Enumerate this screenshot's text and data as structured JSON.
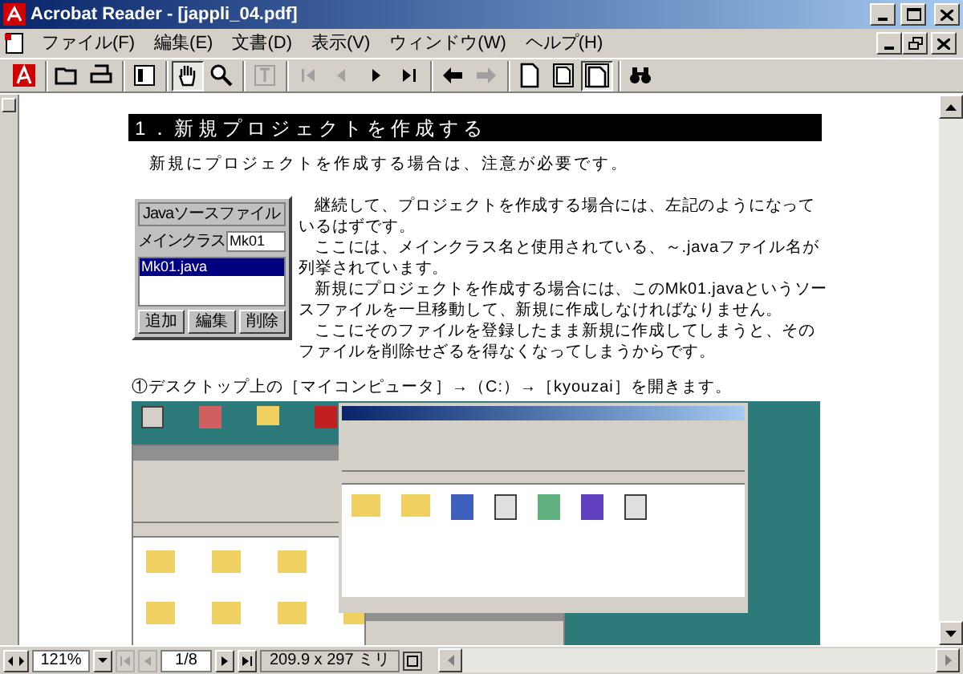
{
  "window": {
    "title": "Acrobat Reader - [jappli_04.pdf]"
  },
  "menu": [
    "ファイル(F)",
    "編集(E)",
    "文書(D)",
    "表示(V)",
    "ウィンドウ(W)",
    "ヘルプ(H)"
  ],
  "toolbar_groups": [
    {
      "buttons": [
        {
          "kind": "acrobat",
          "selected": false,
          "disabled": false
        }
      ]
    },
    {
      "buttons": [
        {
          "kind": "open",
          "selected": false,
          "disabled": false
        },
        {
          "kind": "print",
          "selected": false,
          "disabled": false
        }
      ]
    },
    {
      "buttons": [
        {
          "kind": "navpane",
          "selected": false,
          "disabled": false
        }
      ]
    },
    {
      "buttons": [
        {
          "kind": "hand",
          "selected": true,
          "disabled": false
        },
        {
          "kind": "zoom",
          "selected": false,
          "disabled": false
        }
      ]
    },
    {
      "buttons": [
        {
          "kind": "text",
          "selected": false,
          "disabled": true
        }
      ]
    },
    {
      "buttons": [
        {
          "kind": "first",
          "selected": false,
          "disabled": true
        },
        {
          "kind": "prev",
          "selected": false,
          "disabled": true
        },
        {
          "kind": "next",
          "selected": false,
          "disabled": false
        },
        {
          "kind": "last",
          "selected": false,
          "disabled": false
        }
      ]
    },
    {
      "buttons": [
        {
          "kind": "back",
          "selected": false,
          "disabled": false
        },
        {
          "kind": "forward",
          "selected": false,
          "disabled": true
        }
      ]
    },
    {
      "buttons": [
        {
          "kind": "actual",
          "selected": false,
          "disabled": false
        },
        {
          "kind": "fitpage",
          "selected": false,
          "disabled": false
        },
        {
          "kind": "fitwidth",
          "selected": true,
          "disabled": false
        }
      ]
    },
    {
      "buttons": [
        {
          "kind": "find",
          "selected": false,
          "disabled": false
        }
      ]
    }
  ],
  "document": {
    "heading": "1．新規プロジェクトを作成する",
    "intro": "新規にプロジェクトを作成する場合は、注意が必要です。",
    "dialog": {
      "group_label": "Javaソースファイル",
      "field_label": "メインクラス",
      "field_value": "Mk01",
      "list_items": [
        {
          "label": "Mk01.java",
          "selected": true
        }
      ],
      "buttons": [
        "追加",
        "編集",
        "削除"
      ]
    },
    "paragraphs": [
      "継続して、プロジェクトを作成する場合には、左記のようになっているはずです。",
      "ここには、メインクラス名と使用されている、～.javaファイル名が列挙されています。",
      "新規にプロジェクトを作成する場合には、このMk01.javaというソースファイルを一旦移動して、新規に作成しなければなりません。",
      "ここにそのファイルを登録したまま新規に作成してしまうと、そのファイルを削除せざるを得なくなってしまうからです。"
    ],
    "step": "①デスクトップ上の［マイコンピュータ］→（C:）→［kyouzai］を開きます。"
  },
  "status_bar": {
    "zoom": "121%",
    "page": "1/8",
    "page_size": "209.9 x 297 ミリ"
  }
}
